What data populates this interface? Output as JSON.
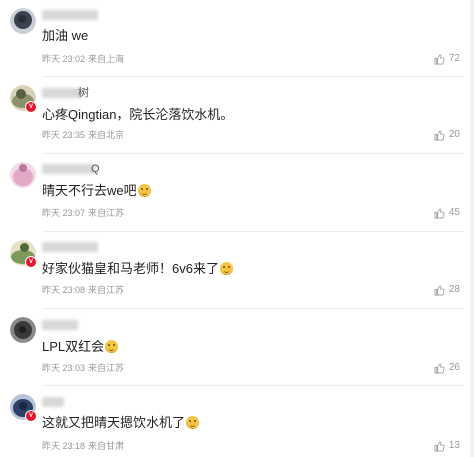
{
  "comments": [
    {
      "name_visible": "",
      "avatar_colors": [
        "#3b4350",
        "#c9cfd6",
        "#2a2f38"
      ],
      "verified": false,
      "content": "加油 we",
      "emoji": false,
      "date": "昨天 23:02",
      "location": "来自上海",
      "likes": "72"
    },
    {
      "name_visible": "树",
      "avatar_colors": [
        "#8b8f6a",
        "#d9d2b8",
        "#5a5e42"
      ],
      "verified": true,
      "content": "心疼Qingtian，院长沦落饮水机。",
      "emoji": false,
      "date": "昨天 23:35",
      "location": "来自北京",
      "likes": "20"
    },
    {
      "name_visible": "Q",
      "avatar_colors": [
        "#e2a9c7",
        "#f4d8e6",
        "#b67aa0"
      ],
      "verified": false,
      "content": "晴天不行去we吧",
      "emoji": true,
      "date": "昨天 23:07",
      "location": "来自江苏",
      "likes": "45"
    },
    {
      "name_visible": "",
      "avatar_colors": [
        "#7c9a5a",
        "#e8e0c8",
        "#4e6a35"
      ],
      "verified": true,
      "content": "好家伙猫皇和马老师！6v6来了",
      "emoji": true,
      "date": "昨天 23:08",
      "location": "来自江苏",
      "likes": "28"
    },
    {
      "name_visible": "",
      "avatar_colors": [
        "#3a3a3a",
        "#8a8a8a",
        "#1f1f1f"
      ],
      "verified": false,
      "content": "LPL双红会",
      "emoji": true,
      "date": "昨天 23:03",
      "location": "来自江苏",
      "likes": "26"
    },
    {
      "name_visible": "",
      "avatar_colors": [
        "#2c3f66",
        "#b7c3d9",
        "#1b2742"
      ],
      "verified": true,
      "content": "这就又把晴天摁饮水机了",
      "emoji": true,
      "date": "昨天 23:18",
      "location": "来自甘肃",
      "likes": "13"
    }
  ],
  "icons": {
    "like": "thumbs-up-icon",
    "verified": "verified-badge-icon",
    "emoji": "smile-emoji-icon"
  },
  "colors": {
    "verified_badge": "#e6162d",
    "meta_text": "#999999",
    "divider": "#ececec"
  }
}
